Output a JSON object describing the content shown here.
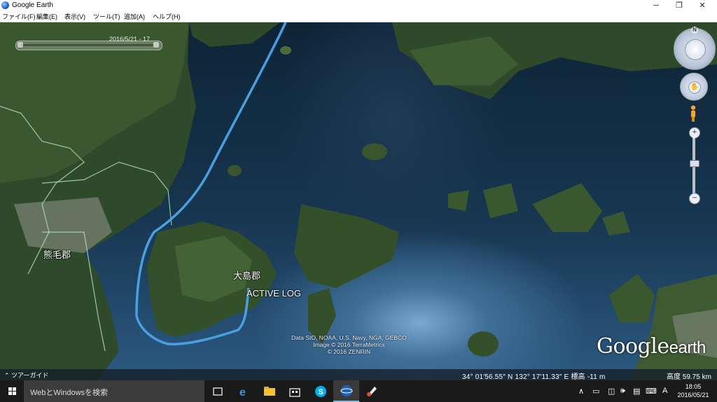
{
  "window": {
    "title": "Google Earth",
    "controls": {
      "minimize": "─",
      "maximize": "❐",
      "close": "✕"
    }
  },
  "menu": [
    "ファイル(F)",
    "編集(E)",
    "表示(V)",
    "ツール(T)",
    "追加(A)",
    "ヘルプ(H)"
  ],
  "time_slider": {
    "label": "2016/5/21 - 17"
  },
  "map": {
    "places": [
      {
        "label": "熊毛郡"
      },
      {
        "label": "大島郡"
      },
      {
        "label": "ACTIVE LOG"
      }
    ],
    "track_color": "#4a9fe0",
    "attribution": [
      "Data SIO, NOAA, U.S. Navy, NGA, GEBCO",
      "Image © 2016 TerraMetrics",
      "© 2016 ZENRIN"
    ],
    "brand": {
      "google": "Google",
      "earth": "earth"
    }
  },
  "nav": {
    "north": "N",
    "zoom_in": "+",
    "zoom_out": "−",
    "zoom_level": 0.55
  },
  "status": {
    "tour": "ツアーガイド",
    "coords": "34° 01′56.55″ N 132° 17′11.33″ E 標高 -11 m",
    "altitude": "高度 59.75 km"
  },
  "taskbar": {
    "search_placeholder": "WebとWindowsを検索",
    "apps": [
      "task-view-icon",
      "edge-icon",
      "file-explorer-icon",
      "store-icon",
      "skype-icon",
      "google-earth-icon",
      "paint-icon"
    ],
    "tray": {
      "chevron": "∧",
      "ime": "A"
    },
    "time": "18:05",
    "date": "2016/05/21"
  }
}
